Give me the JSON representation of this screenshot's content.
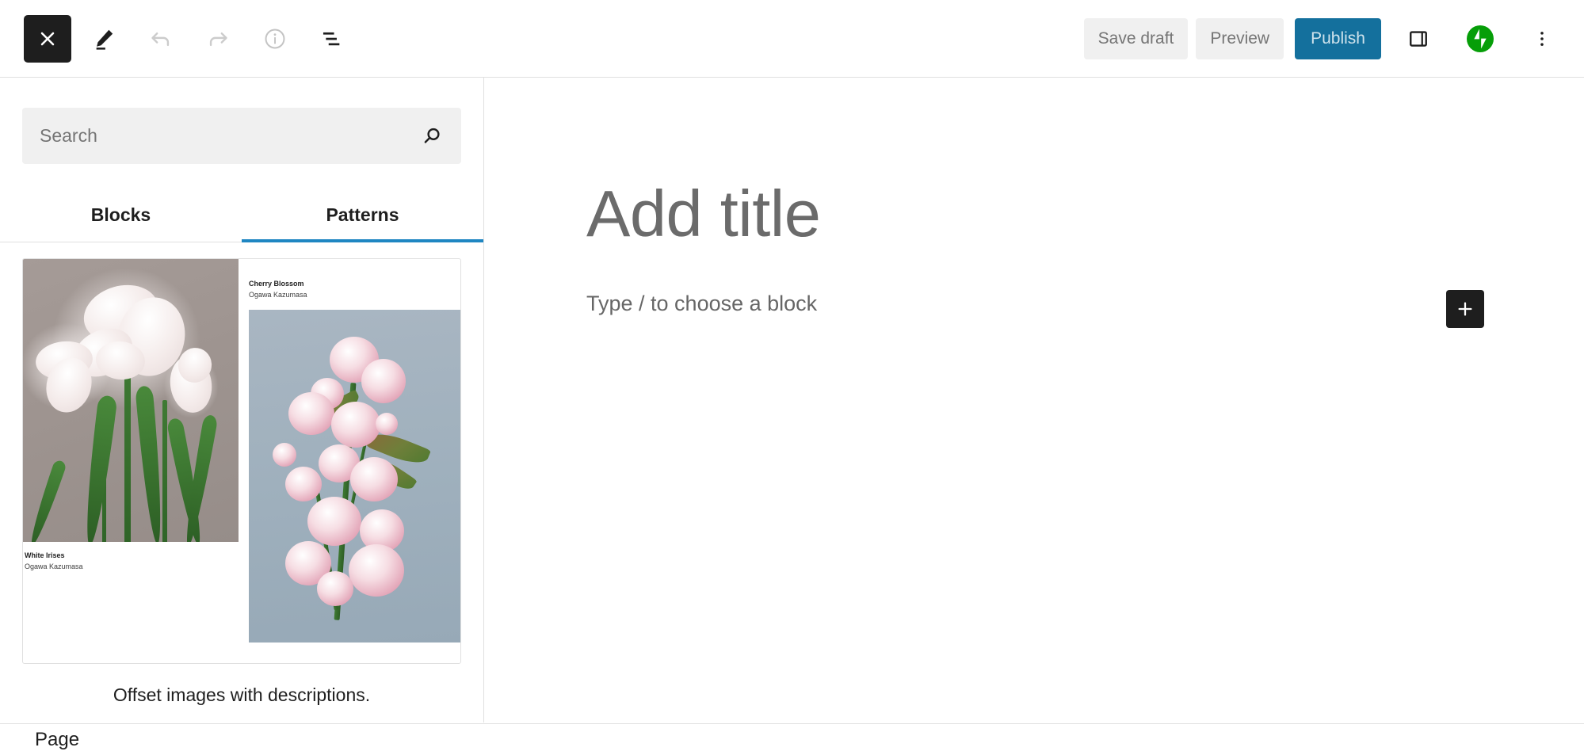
{
  "header": {
    "close_label": "Close",
    "icons": {
      "close": "close-icon",
      "edit": "pencil-icon",
      "undo": "undo-icon",
      "redo": "redo-icon",
      "info": "info-icon",
      "list_view": "list-view-icon",
      "sidebar_toggle": "sidebar-panel-icon",
      "jetpack": "jetpack-icon",
      "more": "more-options-vertical-icon"
    },
    "save_draft_label": "Save draft",
    "preview_label": "Preview",
    "publish_label": "Publish",
    "publish_bg": "#14709d"
  },
  "sidebar": {
    "search": {
      "placeholder": "Search",
      "value": "",
      "icon": "search-icon"
    },
    "tabs": [
      {
        "label": "Blocks",
        "active": false
      },
      {
        "label": "Patterns",
        "active": true
      }
    ],
    "active_tab_underline_color": "#1f86c2",
    "patterns": [
      {
        "caption": "Offset images with descriptions.",
        "items": [
          {
            "title": "White Irises",
            "credit": "Ogawa Kazumasa"
          },
          {
            "title": "Cherry Blossom",
            "credit": "Ogawa Kazumasa"
          }
        ]
      }
    ]
  },
  "editor": {
    "title_placeholder": "Add title",
    "body_placeholder": "Type / to choose a block",
    "add_block_icon": "plus-icon"
  },
  "footer": {
    "breadcrumb": [
      "Page"
    ]
  }
}
